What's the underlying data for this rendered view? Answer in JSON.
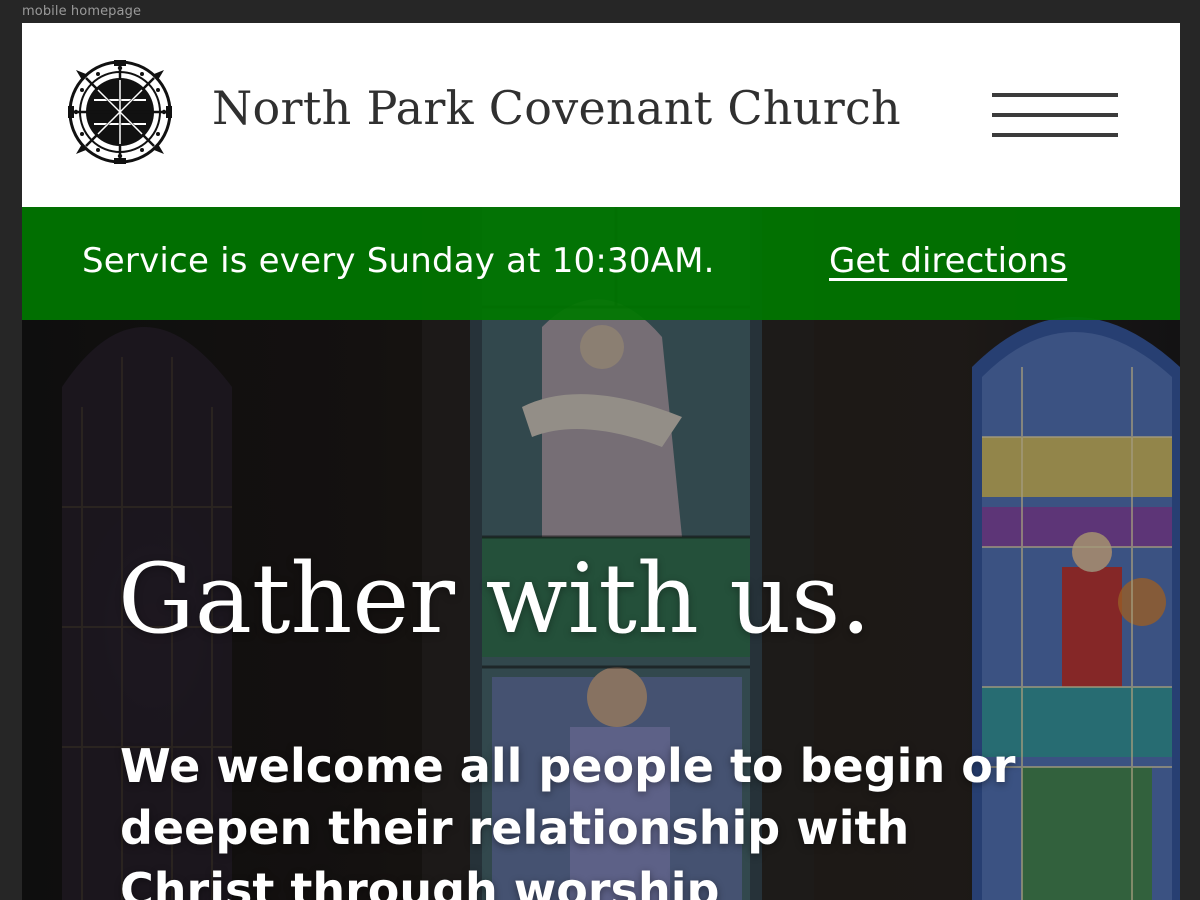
{
  "frame": {
    "label": "mobile homepage"
  },
  "header": {
    "logo_icon": "church-cross-seal-icon",
    "title": "North Park Covenant Church",
    "menu_icon": "hamburger-menu-icon"
  },
  "banner": {
    "text": "Service is every Sunday at 10:30AM.",
    "link_label": "Get directions",
    "color": "#007600"
  },
  "hero": {
    "background_image": "stained-glass-windows",
    "heading": "Gather with us.",
    "subheading": "We welcome all people to begin or deepen their relationship with Christ through worship"
  }
}
